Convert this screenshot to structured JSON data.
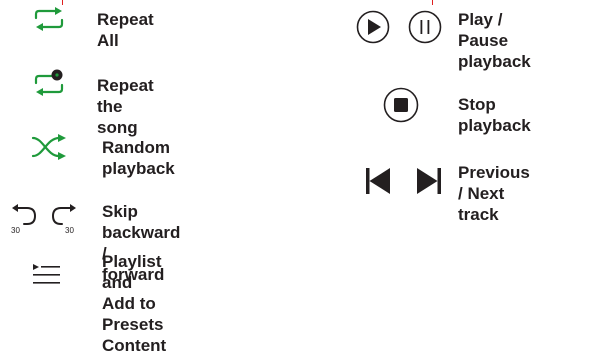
{
  "colors": {
    "accent": "#1f9a3b",
    "text": "#231f20",
    "marker": "#e02020"
  },
  "legend": {
    "left": [
      {
        "icon": "repeat-all-icon",
        "label": "Repeat All"
      },
      {
        "icon": "repeat-one-icon",
        "label": "Repeat the song"
      },
      {
        "icon": "shuffle-icon",
        "label": "Random playback"
      },
      {
        "icon": "skip-back-forward-icon",
        "label": "Skip backward /\nforward",
        "skip_seconds": "30"
      },
      {
        "icon": "playlist-icon",
        "label": "Playlist and Add to\nPresets Content"
      }
    ],
    "right": [
      {
        "icon": "play-pause-icon",
        "label": "Play / Pause\nplayback"
      },
      {
        "icon": "stop-icon",
        "label": "Stop playback"
      },
      {
        "icon": "previous-next-icon",
        "label": "Previous / Next\ntrack"
      }
    ]
  }
}
